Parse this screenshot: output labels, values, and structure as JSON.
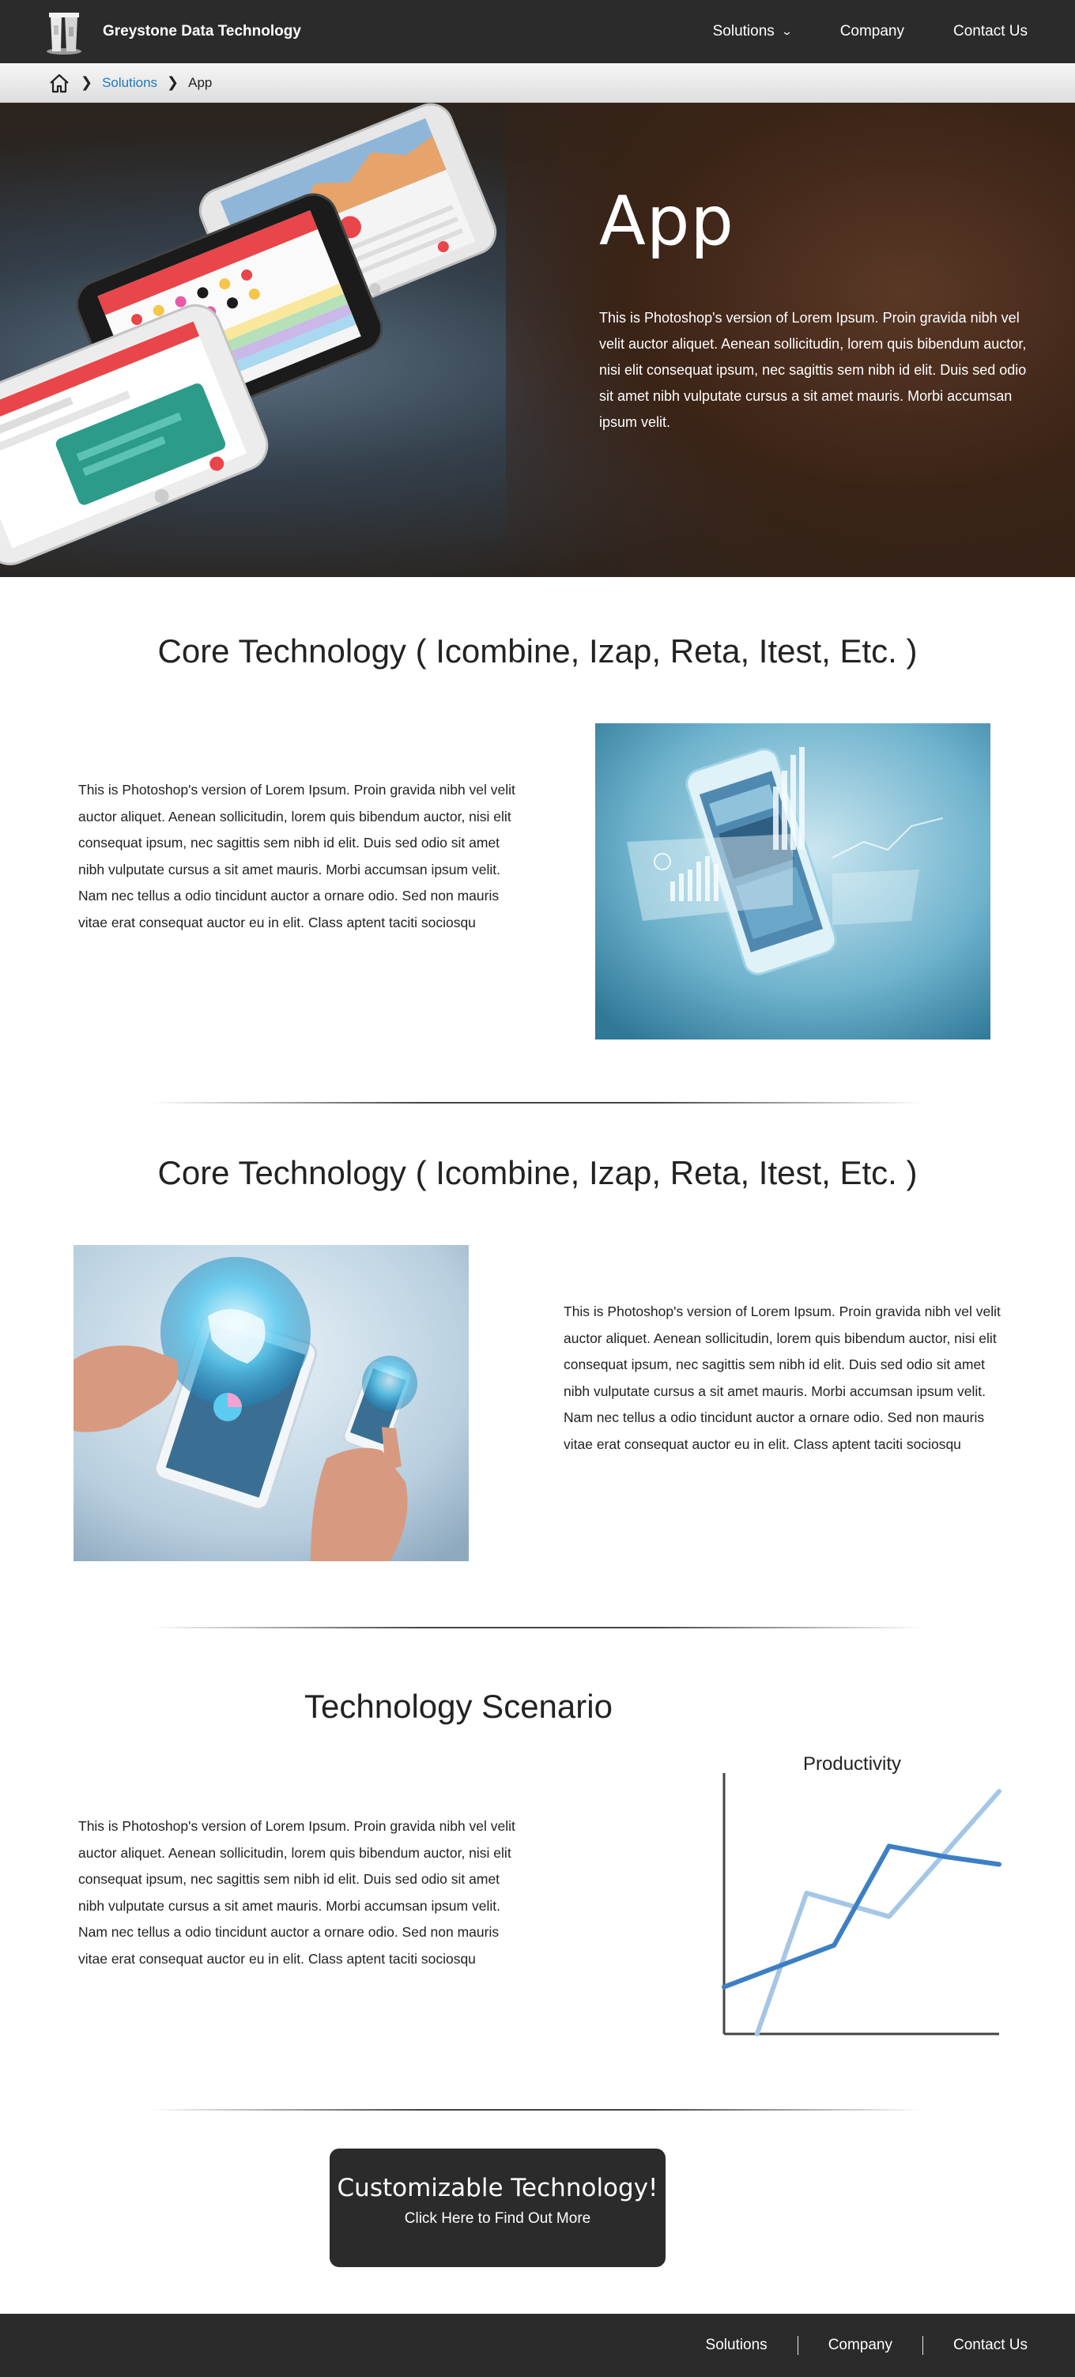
{
  "header": {
    "brand": "Greystone Data Technology",
    "nav": [
      {
        "label": "Solutions",
        "icon": "chevron-down-icon"
      },
      {
        "label": "Company"
      },
      {
        "label": "Contact Us"
      }
    ]
  },
  "breadcrumb": {
    "home_icon": "home-icon",
    "separator_icon": "chevron-right-icon",
    "items": [
      "Solutions",
      "App"
    ]
  },
  "hero": {
    "title": "App",
    "text": "This is Photoshop's version  of Lorem Ipsum. Proin gravida nibh vel velit auctor aliquet. Aenean sollicitudin, lorem quis bibendum auctor, nisi elit consequat ipsum, nec sagittis sem nibh id elit. Duis sed odio sit amet nibh vulputate cursus a sit amet mauris. Morbi accumsan ipsum velit."
  },
  "sections": [
    {
      "title": "Core Technology ( Icombine, Izap, Reta,  Itest, Etc. )",
      "text": "This is Photoshop's version  of Lorem Ipsum. Proin gravida nibh vel velit auctor aliquet. Aenean sollicitudin, lorem quis bibendum auctor, nisi elit consequat ipsum, nec sagittis sem nibh id elit. Duis sed odio sit amet nibh vulputate cursus a sit amet mauris. Morbi accumsan ipsum velit. Nam nec tellus a odio tincidunt auctor a ornare odio. Sed non  mauris vitae erat consequat auctor eu in elit. Class aptent taciti sociosqu"
    },
    {
      "title": "Core Technology ( Icombine, Izap, Reta,  Itest, Etc. )",
      "text": "This is Photoshop's version  of Lorem Ipsum. Proin gravida nibh vel velit auctor aliquet. Aenean sollicitudin, lorem quis bibendum auctor, nisi elit consequat ipsum, nec sagittis sem nibh id elit. Duis sed odio sit amet nibh vulputate cursus a sit amet mauris. Morbi accumsan ipsum velit. Nam nec tellus a odio tincidunt auctor a ornare odio. Sed non  mauris vitae erat consequat auctor eu in elit. Class aptent taciti sociosqu"
    },
    {
      "title": "Technology Scenario",
      "text": "This is Photoshop's version  of Lorem Ipsum. Proin gravida nibh vel velit auctor aliquet. Aenean sollicitudin, lorem quis bibendum auctor, nisi elit consequat ipsum, nec sagittis sem nibh id elit. Duis sed odio sit amet nibh vulputate cursus a sit amet mauris. Morbi accumsan ipsum velit. Nam nec tellus a odio tincidunt auctor a ornare odio. Sed non  mauris vitae erat consequat auctor eu in elit. Class aptent taciti sociosqu"
    }
  ],
  "chart_data": {
    "type": "line",
    "title": "Productivity",
    "xlabel": "",
    "ylabel": "",
    "x": [
      0,
      1,
      2,
      3,
      4,
      5
    ],
    "xlim": [
      0,
      5
    ],
    "ylim": [
      0,
      10
    ],
    "grid": false,
    "series": [
      {
        "color": "#3d7fc4",
        "x": [
          0,
          2,
          3,
          4,
          5
        ],
        "values": [
          1.8,
          3.4,
          7.2,
          6.8,
          6.5
        ]
      },
      {
        "color": "#a5c6e6",
        "x": [
          0.6,
          1.5,
          3,
          5
        ],
        "values": [
          0,
          5.4,
          4.5,
          9.3
        ]
      }
    ]
  },
  "cta": {
    "title": "Customizable Technology!",
    "subtitle": "Click Here to Find Out More"
  },
  "footer": {
    "links": [
      "Solutions",
      "Company",
      "Contact Us"
    ]
  },
  "colors": {
    "dark_bar": "#2b2b2b",
    "link": "#2178c4",
    "chart_dark": "#3d7fc4",
    "chart_light": "#a5c6e6"
  }
}
